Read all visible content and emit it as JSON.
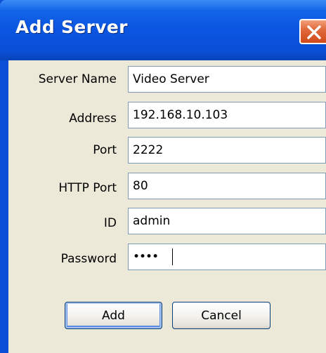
{
  "window": {
    "title": "Add Server"
  },
  "form": {
    "server_name": {
      "label": "Server Name",
      "value": "Video Server"
    },
    "address": {
      "label": "Address",
      "value": "192.168.10.103"
    },
    "port": {
      "label": "Port",
      "value": "2222"
    },
    "http_port": {
      "label": "HTTP Port",
      "value": "80"
    },
    "id": {
      "label": "ID",
      "value": "admin"
    },
    "password": {
      "label": "Password",
      "value": "••••"
    }
  },
  "buttons": {
    "add_label": "Add",
    "cancel_label": "Cancel"
  },
  "icons": {
    "close": "close-icon"
  },
  "colors": {
    "titlebar": "#0a4fd6",
    "client_bg": "#ece9d8",
    "close_button": "#e06a3c",
    "field_border": "#7f9db9"
  }
}
